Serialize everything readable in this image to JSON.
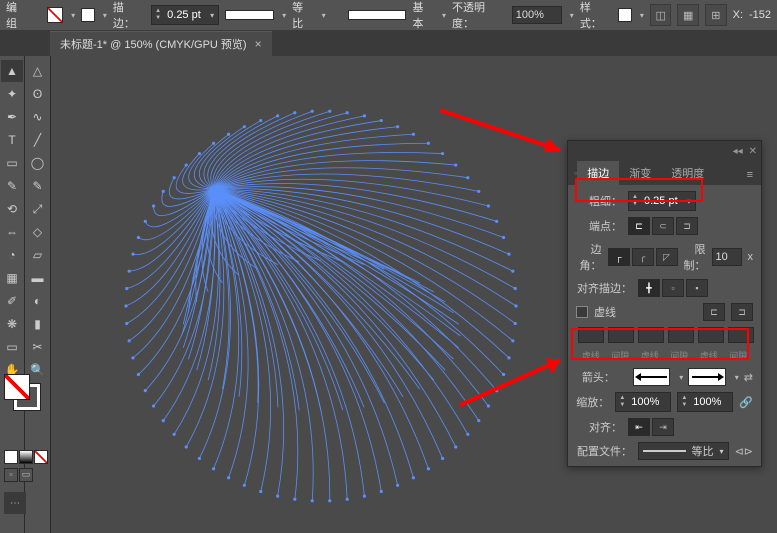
{
  "optionbar": {
    "mode_label": "编组",
    "stroke_label": "描边：",
    "stroke_weight": "0.25 pt",
    "ratio_label": "等比",
    "basic_label": "基本",
    "opacity_label": "不透明度：",
    "opacity_value": "100%",
    "style_label": "样式：",
    "x_label": "X:",
    "x_value": "-152"
  },
  "tab": {
    "title": "未标题-1* @ 150% (CMYK/GPU 预览)"
  },
  "panel": {
    "tabs": {
      "stroke": "描边",
      "gradient": "渐变",
      "transparency": "透明度"
    },
    "weight_label": "粗细：",
    "weight_value": "0.25 pt",
    "cap_label": "端点：",
    "corner_label": "边角：",
    "limit_label": "限制：",
    "limit_value": "10",
    "limit_unit": "x",
    "align_label": "对齐描边：",
    "dashed_label": "虚线",
    "dash_headers": [
      "虚线",
      "间隙",
      "虚线",
      "间隙",
      "虚线",
      "间隙"
    ],
    "arrow_label": "箭头：",
    "scale_label": "缩放：",
    "scale_value": "100%",
    "align2_label": "对齐：",
    "profile_label": "配置文件：",
    "profile_value": "等比"
  },
  "colors": {
    "accent": "#5b8ff9",
    "highlight": "#ff0000"
  }
}
